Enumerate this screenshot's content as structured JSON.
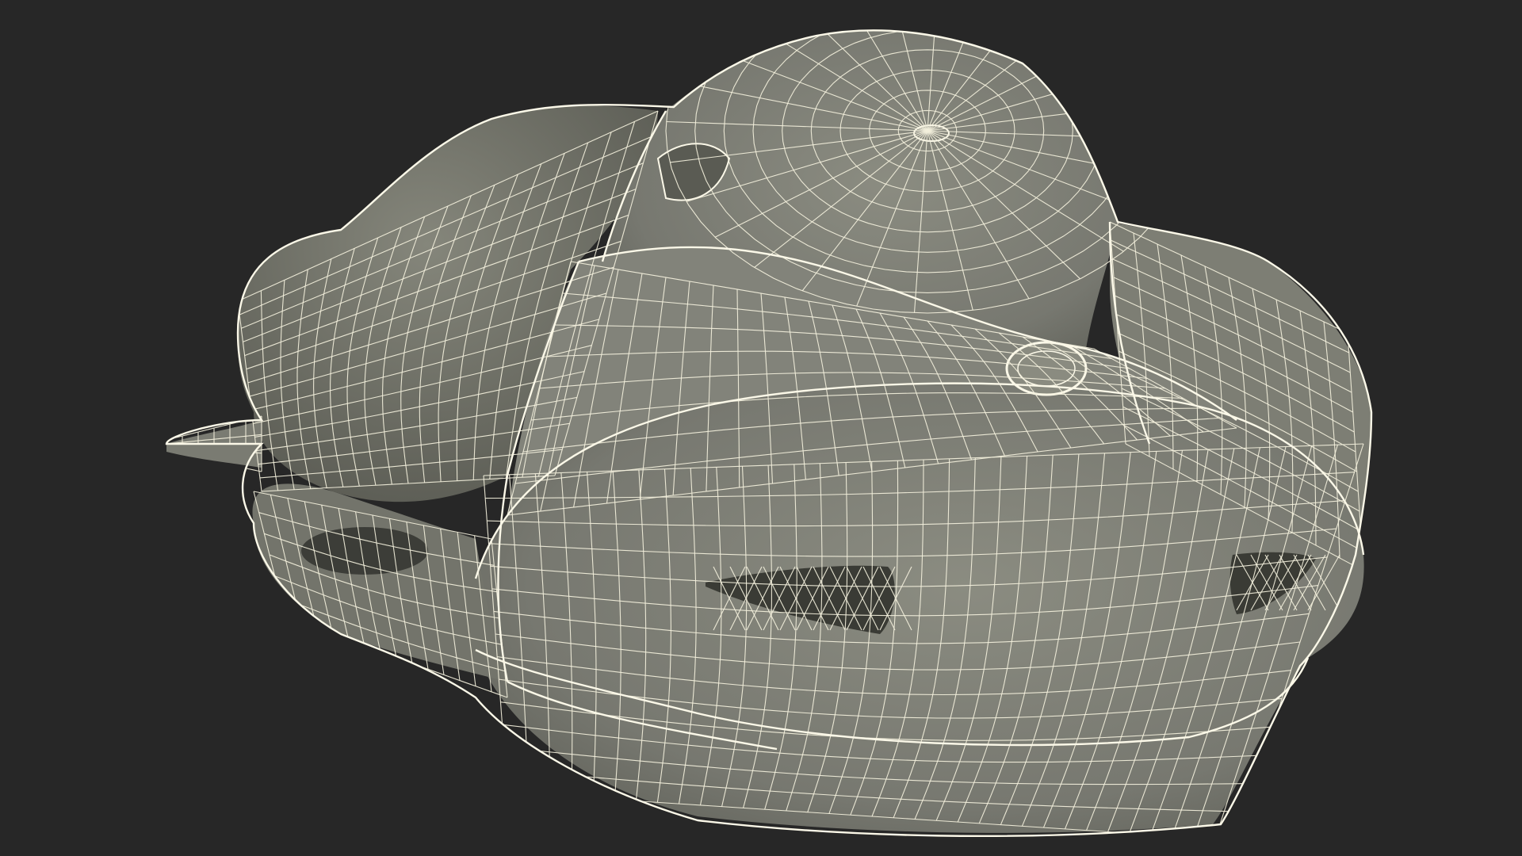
{
  "scene": {
    "subject": "wireframe-mesh-object",
    "colors": {
      "background": "#272727",
      "surface": "#7b7c72",
      "surface_light": "#8a8b80",
      "surface_dark": "#5f6058",
      "wire": "#f3f0dc",
      "edge": "#fbf8e8"
    },
    "icons": []
  }
}
